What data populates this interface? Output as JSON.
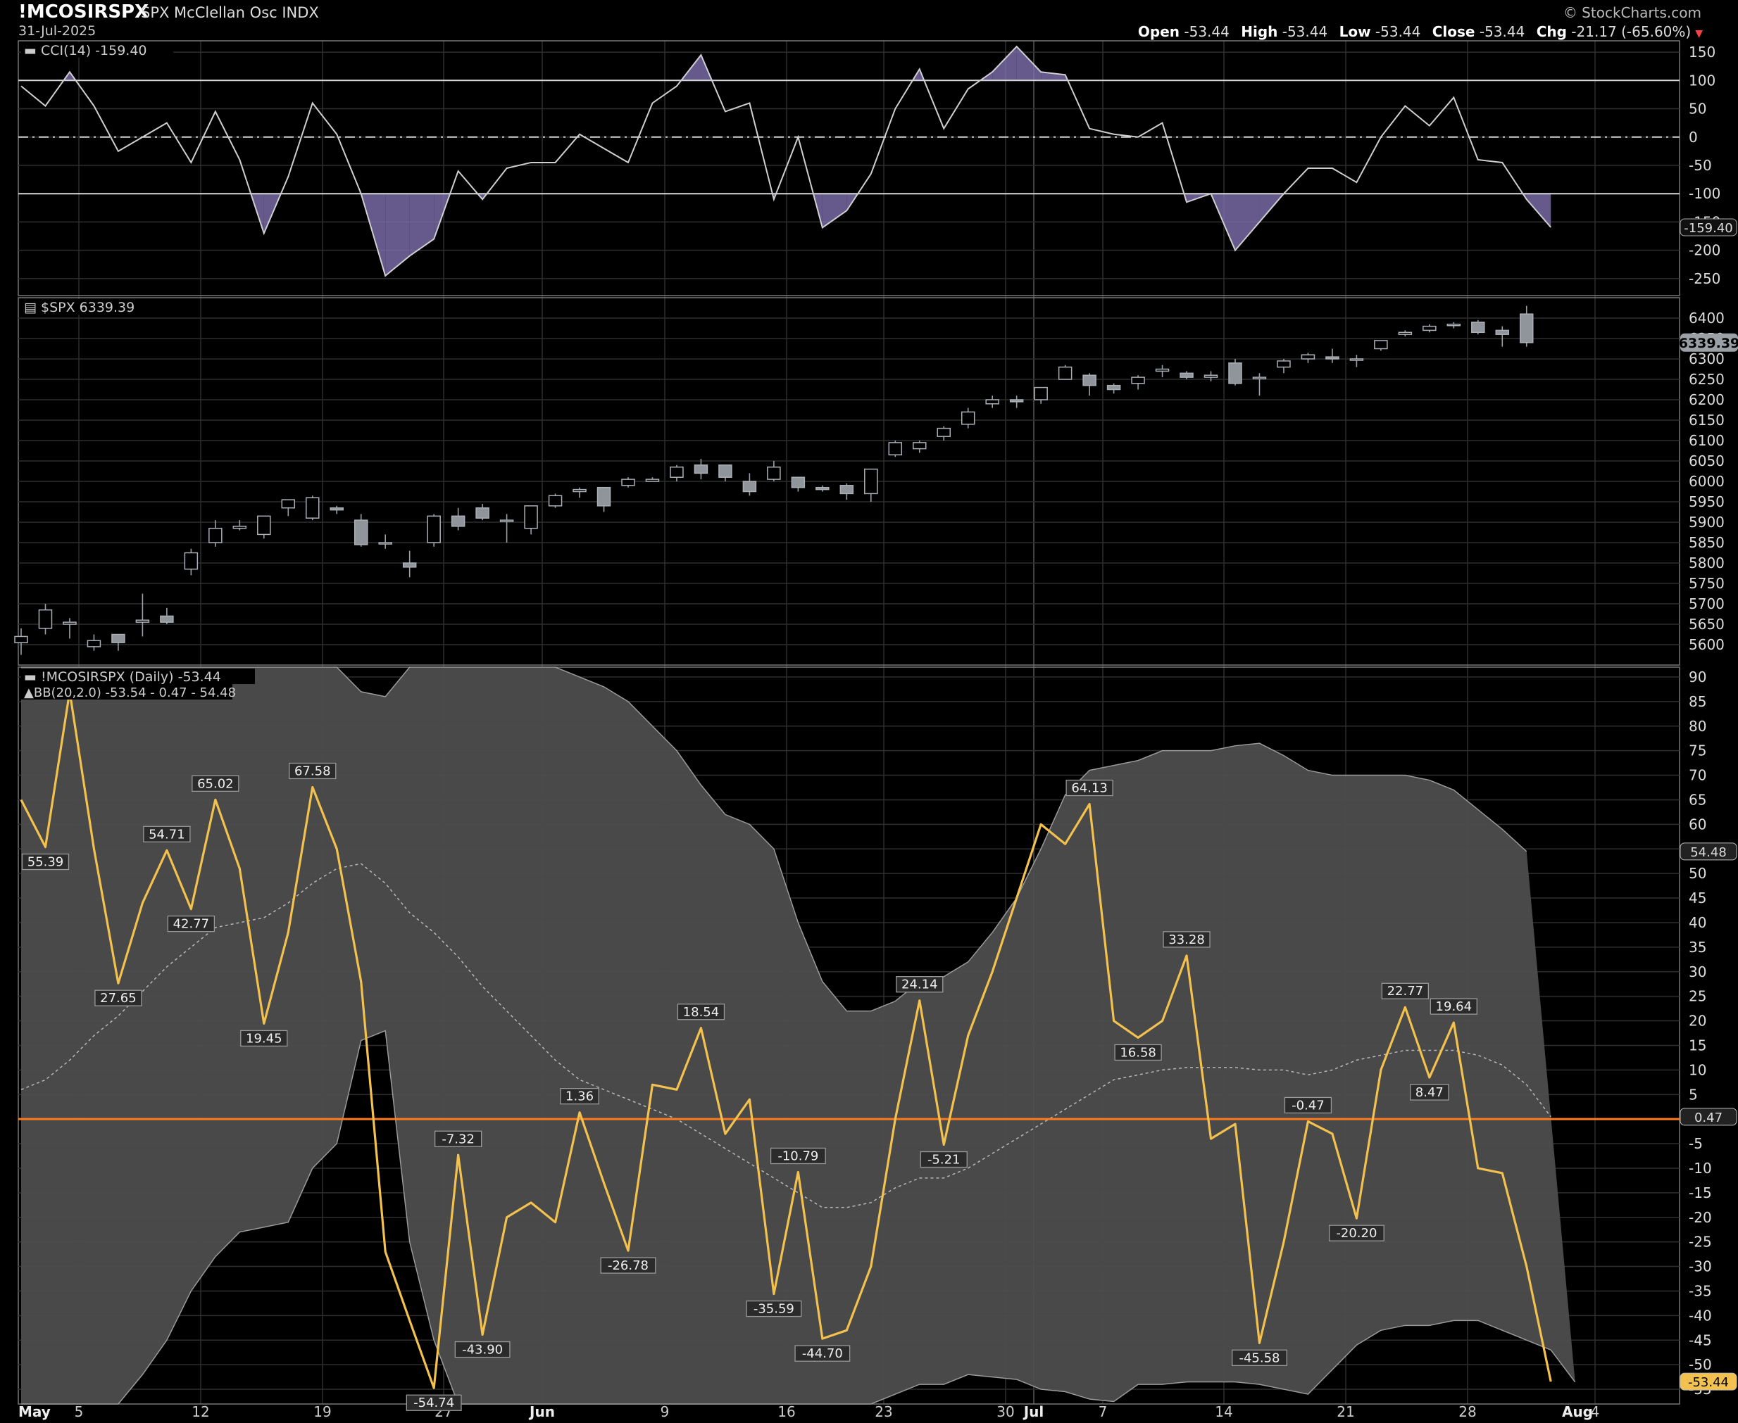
{
  "header": {
    "symbol": "!MCOSIRSPX",
    "description": "SPX McClellan Osc INDX",
    "date": "31-Jul-2025",
    "brand": "© StockCharts.com",
    "open_label": "Open",
    "open": "-53.44",
    "high_label": "High",
    "high": "-53.44",
    "low_label": "Low",
    "low": "-53.44",
    "close_label": "Close",
    "close": "-53.44",
    "chg_label": "Chg",
    "chg": "-21.17 (-65.60%)",
    "chg_marker": "▼"
  },
  "colors": {
    "background": "#000000",
    "grid": "#2e2e2e",
    "cci_line": "#cfcfcf",
    "cci_fill": "#8070b0",
    "osc_line": "#f2c14e",
    "zero_line": "#ff7a1a",
    "bb_band": "#4d4d4d",
    "candle_up": "#000000",
    "candle_down": "#8f959b"
  },
  "x_axis": {
    "labels": [
      {
        "text": "May",
        "bold": true
      },
      {
        "text": "5"
      },
      {
        "text": "12"
      },
      {
        "text": "19"
      },
      {
        "text": "27"
      },
      {
        "text": "Jun",
        "bold": true
      },
      {
        "text": "9"
      },
      {
        "text": "16"
      },
      {
        "text": "23"
      },
      {
        "text": "30"
      },
      {
        "text": "Jul",
        "bold": true
      },
      {
        "text": "7"
      },
      {
        "text": "14"
      },
      {
        "text": "21"
      },
      {
        "text": "28"
      },
      {
        "text": "Aug",
        "bold": true
      },
      {
        "text": "4"
      }
    ]
  },
  "chart_data": [
    {
      "type": "line",
      "title": "CCI(14)",
      "last_value": "-159.40",
      "reference_lines": [
        100,
        0,
        -100
      ],
      "ylim": [
        -280,
        170
      ],
      "yticks": [
        150,
        100,
        50,
        0,
        -50,
        -100,
        -150,
        -200,
        -250
      ],
      "series": [
        {
          "name": "CCI(14)",
          "values": [
            90,
            55,
            115,
            55,
            -25,
            0,
            25,
            -45,
            45,
            -40,
            -170,
            -70,
            60,
            5,
            -100,
            -245,
            -210,
            -180,
            -60,
            -110,
            -55,
            -45,
            -45,
            5,
            -20,
            -45,
            60,
            90,
            145,
            45,
            60,
            -110,
            0,
            -160,
            -130,
            -65,
            50,
            120,
            15,
            85,
            115,
            160,
            115,
            110,
            15,
            5,
            0,
            25,
            -115,
            -100,
            -200,
            -150,
            -100,
            -55,
            -55,
            -80,
            0,
            55,
            20,
            70,
            -40,
            -45,
            -110,
            -159.4
          ]
        }
      ]
    },
    {
      "type": "candlestick",
      "title": "$SPX",
      "last_value": "6339.39",
      "ylim": [
        5550,
        6450
      ],
      "yticks": [
        6400,
        6350,
        6300,
        6250,
        6200,
        6150,
        6100,
        6050,
        6000,
        5950,
        5900,
        5850,
        5800,
        5750,
        5700,
        5650,
        5600
      ],
      "candles": [
        [
          5605,
          5640,
          5575,
          5620
        ],
        [
          5640,
          5700,
          5625,
          5685
        ],
        [
          5650,
          5665,
          5615,
          5655
        ],
        [
          5595,
          5625,
          5585,
          5610
        ],
        [
          5625,
          5625,
          5585,
          5605
        ],
        [
          5655,
          5725,
          5620,
          5660
        ],
        [
          5670,
          5690,
          5650,
          5655
        ],
        [
          5785,
          5835,
          5770,
          5825
        ],
        [
          5850,
          5905,
          5840,
          5885
        ],
        [
          5885,
          5905,
          5880,
          5890
        ],
        [
          5870,
          5915,
          5860,
          5915
        ],
        [
          5935,
          5955,
          5915,
          5955
        ],
        [
          5910,
          5965,
          5905,
          5960
        ],
        [
          5935,
          5940,
          5920,
          5930
        ],
        [
          5905,
          5920,
          5840,
          5845
        ],
        [
          5850,
          5870,
          5835,
          5850
        ],
        [
          5800,
          5830,
          5765,
          5790
        ],
        [
          5850,
          5920,
          5840,
          5915
        ],
        [
          5915,
          5935,
          5880,
          5890
        ],
        [
          5935,
          5945,
          5905,
          5910
        ],
        [
          5905,
          5920,
          5850,
          5905
        ],
        [
          5885,
          5940,
          5870,
          5940
        ],
        [
          5940,
          5970,
          5935,
          5965
        ],
        [
          5975,
          5985,
          5960,
          5980
        ],
        [
          5985,
          5985,
          5925,
          5940
        ],
        [
          5990,
          6010,
          5985,
          6005
        ],
        [
          6000,
          6010,
          6000,
          6005
        ],
        [
          6010,
          6040,
          6000,
          6035
        ],
        [
          6040,
          6055,
          6005,
          6020
        ],
        [
          6040,
          6040,
          6000,
          6010
        ],
        [
          6000,
          6020,
          5965,
          5975
        ],
        [
          6005,
          6050,
          6000,
          6035
        ],
        [
          6010,
          6010,
          5975,
          5985
        ],
        [
          5985,
          5990,
          5975,
          5980
        ],
        [
          5990,
          5995,
          5955,
          5970
        ],
        [
          5970,
          6030,
          5950,
          6030
        ],
        [
          6065,
          6100,
          6060,
          6095
        ],
        [
          6080,
          6100,
          6070,
          6095
        ],
        [
          6110,
          6135,
          6100,
          6130
        ],
        [
          6140,
          6180,
          6130,
          6170
        ],
        [
          6190,
          6210,
          6180,
          6200
        ],
        [
          6200,
          6210,
          6180,
          6195
        ],
        [
          6200,
          6230,
          6190,
          6230
        ],
        [
          6250,
          6285,
          6250,
          6280
        ],
        [
          6260,
          6265,
          6210,
          6235
        ],
        [
          6235,
          6240,
          6215,
          6225
        ],
        [
          6240,
          6260,
          6225,
          6255
        ],
        [
          6270,
          6285,
          6255,
          6275
        ],
        [
          6265,
          6270,
          6250,
          6255
        ],
        [
          6255,
          6270,
          6245,
          6260
        ],
        [
          6290,
          6300,
          6235,
          6240
        ],
        [
          6255,
          6265,
          6210,
          6255
        ],
        [
          6280,
          6300,
          6265,
          6295
        ],
        [
          6300,
          6315,
          6290,
          6310
        ],
        [
          6305,
          6325,
          6290,
          6300
        ],
        [
          6300,
          6310,
          6280,
          6300
        ],
        [
          6325,
          6345,
          6320,
          6345
        ],
        [
          6360,
          6370,
          6355,
          6365
        ],
        [
          6370,
          6385,
          6365,
          6380
        ],
        [
          6385,
          6390,
          6375,
          6385
        ],
        [
          6390,
          6395,
          6360,
          6365
        ],
        [
          6370,
          6380,
          6330,
          6360
        ],
        [
          6410,
          6430,
          6330,
          6340
        ]
      ]
    },
    {
      "type": "line",
      "title": "!MCOSIRSPX (Daily)",
      "last_value": "-53.44",
      "overlay": "BB(20,2.0)",
      "overlay_values": "-53.54 - 0.47 - 54.48",
      "bb_mid_last": "0.47",
      "bb_upper_last": "54.48",
      "ylim": [
        -58,
        92
      ],
      "yticks": [
        90,
        85,
        80,
        75,
        70,
        65,
        60,
        55,
        50,
        45,
        40,
        35,
        30,
        25,
        20,
        15,
        10,
        5,
        0,
        -5,
        -10,
        -15,
        -20,
        -25,
        -30,
        -35,
        -40,
        -45,
        -50,
        -55
      ],
      "series": [
        {
          "name": "!MCOSIRSPX (Daily)",
          "values": [
            65,
            55.39,
            87,
            55,
            27.65,
            44,
            54.71,
            42.77,
            65.02,
            51,
            19.45,
            38,
            67.58,
            55,
            28,
            -27,
            -41,
            -54.74,
            -7.32,
            -43.9,
            -20,
            -17,
            -21,
            1.36,
            -13,
            -26.78,
            7,
            6,
            18.54,
            -3,
            4,
            -35.59,
            -10.79,
            -44.7,
            -43,
            -30,
            0,
            24.14,
            -5.21,
            17,
            30,
            45,
            60,
            56,
            64.13,
            20,
            16.58,
            20,
            33.28,
            -4,
            -1,
            -45.58,
            -25,
            -0.47,
            -3,
            -20.2,
            10,
            22.77,
            8.47,
            19.64,
            -10,
            -11,
            -30,
            -53.44
          ]
        },
        {
          "name": "BB Upper",
          "values": [
            120,
            122,
            124,
            122,
            118,
            116,
            112,
            110,
            108,
            104,
            101,
            98,
            95,
            93,
            87,
            86,
            93,
            96,
            96,
            97,
            96,
            98,
            100,
            90,
            88,
            85,
            80,
            75,
            68,
            62,
            60,
            55,
            40,
            28,
            22,
            22,
            24,
            28,
            29,
            32,
            38,
            45,
            55,
            66,
            71,
            72,
            73,
            75,
            75,
            75,
            76,
            76.5,
            74,
            71,
            70,
            70,
            70,
            70,
            69,
            67,
            63,
            59,
            54.48
          ]
        },
        {
          "name": "BB Lower",
          "values": [
            -95,
            -90,
            -80,
            -70,
            -62,
            -52,
            -45,
            -35,
            -28,
            -23,
            -22,
            -21,
            -10,
            -5,
            16,
            18,
            -25,
            -45,
            -60,
            -62,
            -67,
            -72,
            -78,
            -82,
            -85,
            -88,
            -75,
            -70,
            -65,
            -62,
            -60,
            -62,
            -60,
            -58,
            -58.5,
            -59,
            -56,
            -54,
            -54,
            -52,
            -52.5,
            -53,
            -55,
            -55.5,
            -57,
            -57.5,
            -54,
            -54,
            -53.5,
            -53.5,
            -53.5,
            -54,
            -55,
            -56,
            -51,
            -46,
            -43,
            -42,
            -42,
            -41,
            -41,
            -43,
            -45,
            -47,
            -53.54
          ]
        },
        {
          "name": "BB Mid",
          "values": [
            6,
            8,
            12,
            17,
            21,
            26,
            31,
            35,
            39,
            40,
            41,
            44,
            48,
            51,
            52,
            48,
            42,
            38,
            33,
            27,
            22,
            17,
            12,
            8,
            6,
            4,
            2,
            0,
            -3,
            -6,
            -9,
            -12,
            -15,
            -18,
            -18,
            -17,
            -14,
            -12,
            -12,
            -10,
            -7,
            -4,
            -1,
            2,
            5,
            8,
            9,
            10,
            10.5,
            10.5,
            10.5,
            10,
            10,
            9,
            10,
            12,
            13,
            14,
            14,
            14,
            13,
            11,
            7,
            0.47
          ]
        }
      ],
      "data_labels": [
        {
          "i": 1,
          "text": "55.39",
          "pos": "below"
        },
        {
          "i": 4,
          "text": "27.65",
          "pos": "below"
        },
        {
          "i": 6,
          "text": "54.71",
          "pos": "above"
        },
        {
          "i": 7,
          "text": "42.77",
          "pos": "below"
        },
        {
          "i": 8,
          "text": "65.02",
          "pos": "above"
        },
        {
          "i": 10,
          "text": "19.45",
          "pos": "below"
        },
        {
          "i": 12,
          "text": "67.58",
          "pos": "above"
        },
        {
          "i": 17,
          "text": "-54.74",
          "pos": "below"
        },
        {
          "i": 18,
          "text": "-7.32",
          "pos": "above"
        },
        {
          "i": 19,
          "text": "-43.90",
          "pos": "below"
        },
        {
          "i": 23,
          "text": "1.36",
          "pos": "above"
        },
        {
          "i": 25,
          "text": "-26.78",
          "pos": "below"
        },
        {
          "i": 28,
          "text": "18.54",
          "pos": "above"
        },
        {
          "i": 31,
          "text": "-35.59",
          "pos": "below"
        },
        {
          "i": 32,
          "text": "-10.79",
          "pos": "above"
        },
        {
          "i": 33,
          "text": "-44.70",
          "pos": "below"
        },
        {
          "i": 37,
          "text": "24.14",
          "pos": "above"
        },
        {
          "i": 38,
          "text": "-5.21",
          "pos": "below"
        },
        {
          "i": 44,
          "text": "64.13",
          "pos": "above"
        },
        {
          "i": 46,
          "text": "16.58",
          "pos": "below"
        },
        {
          "i": 48,
          "text": "33.28",
          "pos": "above"
        },
        {
          "i": 51,
          "text": "-45.58",
          "pos": "below"
        },
        {
          "i": 53,
          "text": "-0.47",
          "pos": "above"
        },
        {
          "i": 55,
          "text": "-20.20",
          "pos": "below"
        },
        {
          "i": 57,
          "text": "22.77",
          "pos": "above"
        },
        {
          "i": 58,
          "text": "8.47",
          "pos": "below"
        },
        {
          "i": 59,
          "text": "19.64",
          "pos": "above"
        }
      ]
    }
  ]
}
